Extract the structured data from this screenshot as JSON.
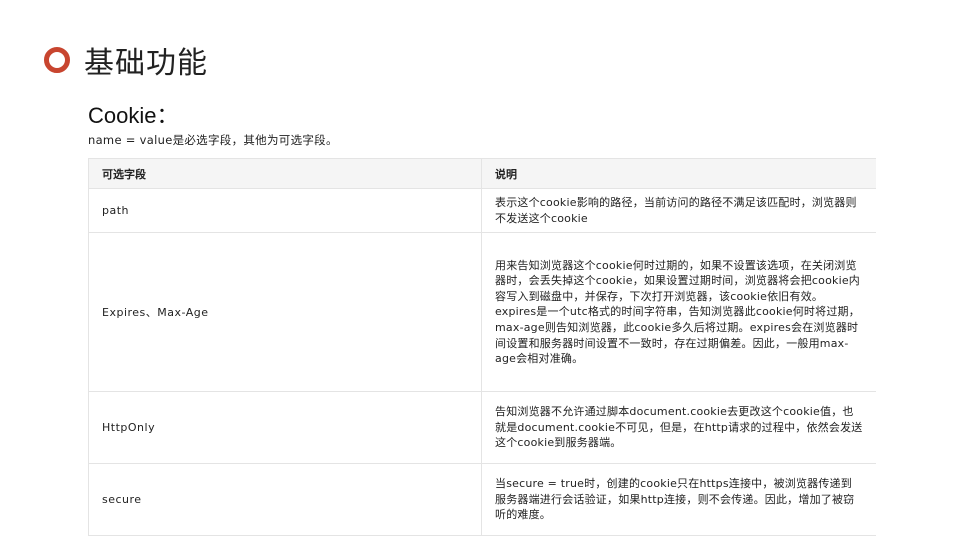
{
  "title": "基础功能",
  "subtitle": "Cookie：",
  "note": "name = value是必选字段，其他为可选字段。",
  "table": {
    "headers": [
      "可选字段",
      "说明"
    ],
    "rows": [
      {
        "field": "path",
        "desc": "表示这个cookie影响的路径，当前访问的路径不满足该匹配时，浏览器则不发送这个cookie"
      },
      {
        "field": "Expires、Max-Age",
        "desc": "用来告知浏览器这个cookie何时过期的，如果不设置该选项，在关闭浏览器时，会丢失掉这个cookie，如果设置过期时间，浏览器将会把cookie内容写入到磁盘中，并保存，下次打开浏览器，该cookie依旧有效。expires是一个utc格式的时间字符串，告知浏览器此cookie何时将过期，max-age则告知浏览器，此cookie多久后将过期。expires会在浏览器时间设置和服务器时间设置不一致时，存在过期偏差。因此，一般用max-age会相对准确。"
      },
      {
        "field": "HttpOnly",
        "desc": "告知浏览器不允许通过脚本document.cookie去更改这个cookie值，也就是document.cookie不可见，但是，在http请求的过程中，依然会发送这个cookie到服务器端。"
      },
      {
        "field": "secure",
        "desc": "当secure = true时，创建的cookie只在https连接中，被浏览器传递到服务器端进行会话验证，如果http连接，则不会传递。因此，增加了被窃听的难度。"
      }
    ]
  }
}
